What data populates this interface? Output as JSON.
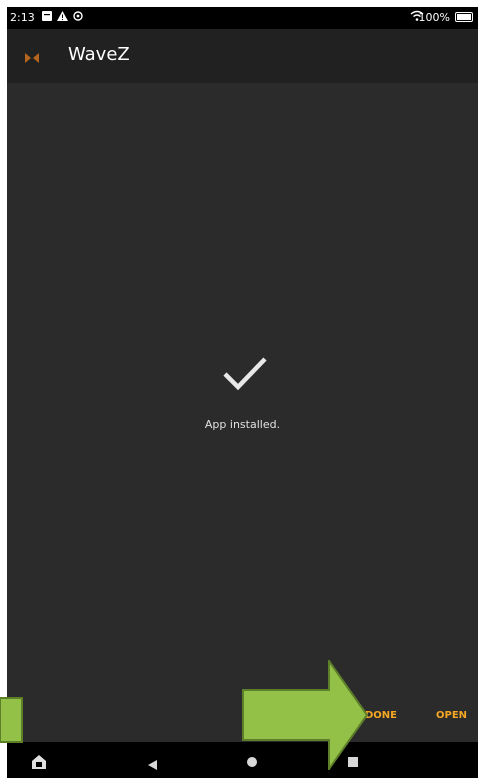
{
  "status_bar": {
    "time": "2:13",
    "icons": [
      "notification-icon",
      "warning-icon",
      "settings-icon"
    ],
    "wifi_icon": "wifi-icon",
    "battery_text": "100%",
    "battery_icon": "battery-charging-icon"
  },
  "app_bar": {
    "logo_icon": "wavez-logo-icon",
    "title": "WaveZ"
  },
  "content": {
    "check_icon": "checkmark-icon",
    "message": "App installed."
  },
  "actions": {
    "done_label": "DONE",
    "open_label": "OPEN"
  },
  "nav_bar": {
    "home_icon": "home-icon",
    "back_icon": "back-icon",
    "overview_icon": "circle-home-icon",
    "recents_icon": "recents-icon"
  },
  "annotations": {
    "arrow_color": "#8fbc4a",
    "arrow_icons": [
      "green-arrow-left",
      "green-arrow-pointing-done"
    ]
  },
  "colors": {
    "accent": "#f5a623",
    "background": "#2b2b2b",
    "app_bar": "#212121"
  }
}
